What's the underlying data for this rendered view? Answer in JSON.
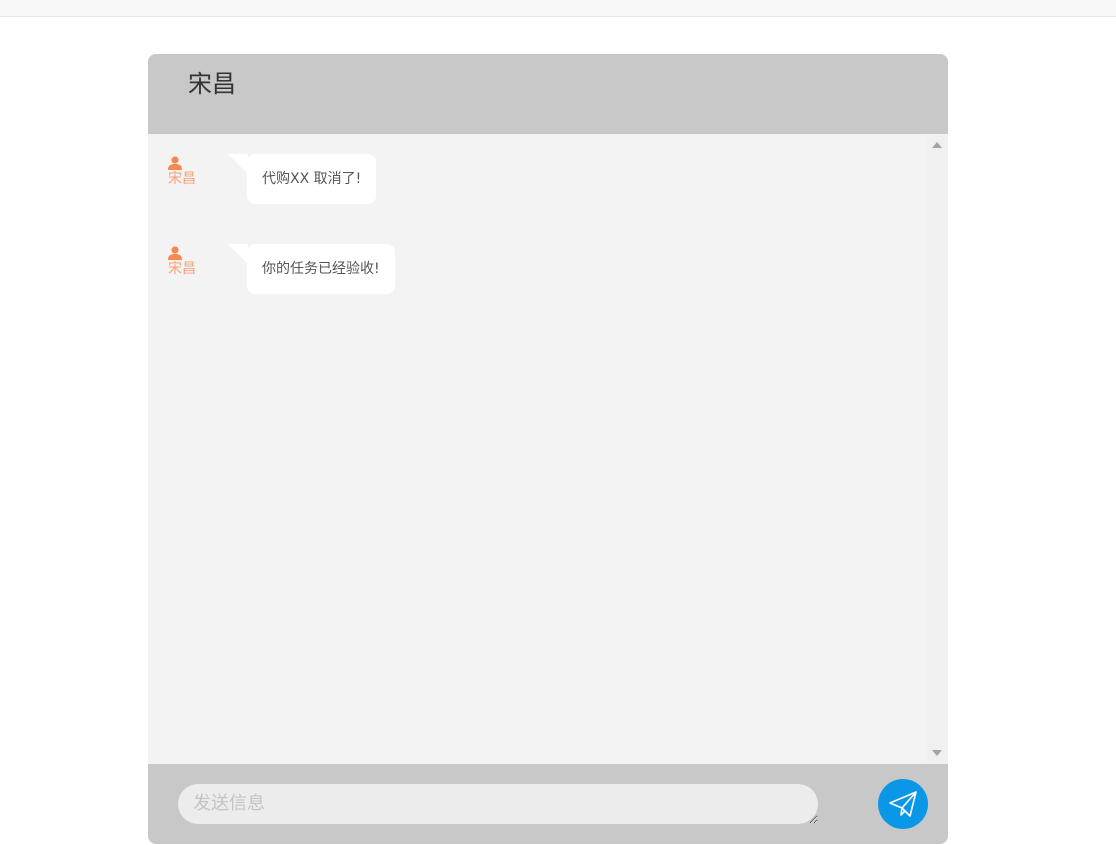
{
  "colors": {
    "header_bg": "#c8c8c8",
    "body_bg": "#f3f3f3",
    "sender_name": "#f7a07a",
    "avatar_icon": "#f5894f",
    "send_button": "#0a97e8"
  },
  "chat": {
    "title": "宋昌",
    "messages": [
      {
        "sender": "宋昌",
        "text": "代购XX 取消了!",
        "icon": "user-icon"
      },
      {
        "sender": "宋昌",
        "text": "你的任务已经验收!",
        "icon": "user-icon"
      }
    ]
  },
  "composer": {
    "placeholder": "发送信息",
    "send_icon": "paper-plane-icon"
  }
}
